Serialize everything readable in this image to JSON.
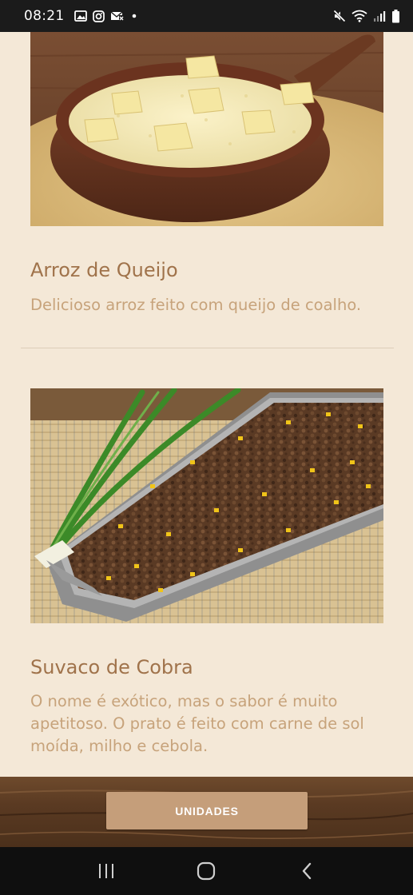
{
  "status_bar": {
    "time": "08:21",
    "left_icons": [
      "image-icon",
      "instagram-icon",
      "mail-icon",
      "dot-icon"
    ],
    "right_icons": [
      "mute-icon",
      "wifi-icon",
      "signal-icon",
      "battery-icon"
    ]
  },
  "menu_items": [
    {
      "title": "Arroz de Queijo",
      "description": "Delicioso arroz feito com queijo de coalho.",
      "image": "rice-with-cheese-photo"
    },
    {
      "title": "Suvaco de Cobra",
      "description": "O nome é exótico, mas o sabor é muito apetitoso. O prato é feito com carne de sol moída, milho e cebola.",
      "image": "ground-beef-corn-photo"
    }
  ],
  "footer": {
    "button_label": "UNIDADES"
  },
  "nav_bar": {
    "icons": [
      "recent-apps-icon",
      "home-icon",
      "back-icon"
    ]
  },
  "colors": {
    "background": "#f4e8d7",
    "title": "#a0734b",
    "description": "#c7a37b",
    "button": "#c59e7a",
    "footer_wood": "#5a3a22"
  }
}
